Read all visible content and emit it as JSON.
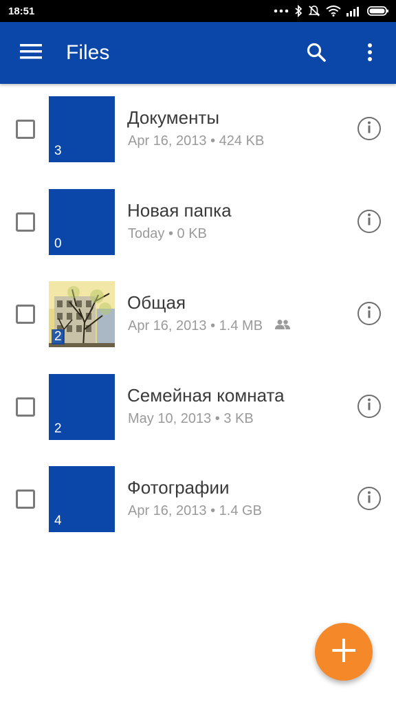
{
  "status_bar": {
    "time": "18:51",
    "icons": [
      "dots-icon",
      "bluetooth-icon",
      "muted-bell-icon",
      "wifi-icon",
      "signal-icon",
      "battery-icon"
    ]
  },
  "app_bar": {
    "title": "Files",
    "color": "#0a47a9",
    "icons": [
      "menu-icon",
      "search-icon",
      "more-vert-icon"
    ]
  },
  "files": [
    {
      "name": "Документы",
      "date": "Apr 16, 2013",
      "size": "424 KB",
      "count": "3",
      "shared": false,
      "thumbnail": "folder"
    },
    {
      "name": "Новая папка",
      "date": "Today",
      "size": "0 KB",
      "count": "0",
      "shared": false,
      "thumbnail": "folder"
    },
    {
      "name": "Общая",
      "date": "Apr 16, 2013",
      "size": "1.4 MB",
      "count": "2",
      "shared": true,
      "thumbnail": "photo"
    },
    {
      "name": "Семейная комната",
      "date": "May 10, 2013",
      "size": "3 KB",
      "count": "2",
      "shared": false,
      "thumbnail": "folder"
    },
    {
      "name": "Фотографии",
      "date": "Apr 16, 2013",
      "size": "1.4 GB",
      "count": "4",
      "shared": false,
      "thumbnail": "folder"
    }
  ],
  "meta_separator": "•",
  "fab": {
    "icon": "plus-icon",
    "color": "#f5892a"
  }
}
